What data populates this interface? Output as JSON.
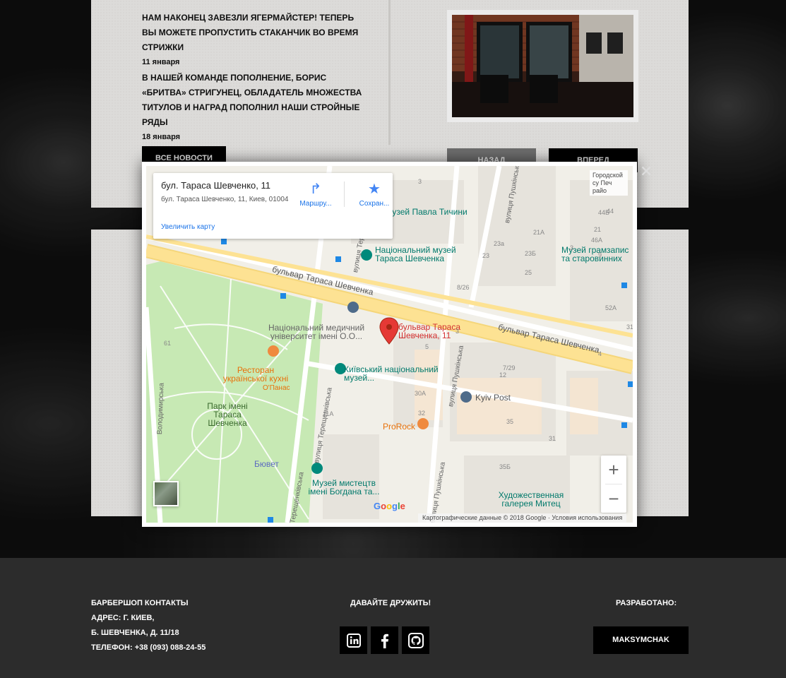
{
  "news": {
    "items": [
      {
        "title": "НАМ НАКОНЕЦ ЗАВЕЗЛИ ЯГЕРМАЙСТЕР! ТЕПЕРЬ ВЫ МОЖЕТЕ ПРОПУСТИТЬ СТАКАНЧИК ВО ВРЕМЯ СТРИЖКИ",
        "date": "11 января"
      },
      {
        "title": "В НАШЕЙ КОМАНДЕ ПОПОЛНЕНИЕ, БОРИС «БРИТВА» СТРИГУНЕЦ, ОБЛАДАТЕЛЬ МНОЖЕСТВА ТИТУЛОВ И НАГРАД ПОПОЛНИЛ НАШИ СТРОЙНЫЕ РЯДЫ",
        "date": "18 января"
      }
    ],
    "all_news_label": "ВСЕ НОВОСТИ",
    "back_label": "НАЗАД",
    "forward_label": "ВПЕРЕД"
  },
  "map": {
    "card": {
      "title": "бул. Тараса Шевченко, 11",
      "address": "бул. Тараса Шевченко, 11, Киев, 01004",
      "enlarge_link": "Увеличить карту",
      "route_label": "Маршру...",
      "save_label": "Сохран..."
    },
    "fullscreen_text": "Городской су Печ райо",
    "pin_label": "бульвар Тараса Шевченка, 11",
    "labels": {
      "museum_tychyny": "музей Павла Тичини",
      "museum_shevchenko": "Національний музей Тараса Шевченка",
      "museum_gramzapis": "Музей грамзапис та старовинних",
      "boulevard_1": "бульвар Тараса Шевченка",
      "boulevard_2": "бульвар Тараса Шевченка",
      "med_university": "Національний медичний університет імені О.О...",
      "restaurant": "Ресторан української кухні",
      "restaurant_sub": "О'Панас",
      "kyiv_museum": "Київський національний музей...",
      "kyiv_post": "Kyiv Post",
      "park": "Парк імені Тараса Шевченка",
      "prorock": "ProRock",
      "buvet": "Бювет",
      "museum_khanenko": "Музей мистецтв імені Богдана та...",
      "art_gallery": "Художественная галерея Митец",
      "st_volodymyrska": "Володимирська",
      "st_tereshchenkivska": "вулиця Терещенківська",
      "st_pushkinska": "вулиця Пушкінська",
      "st_pushkinska_2": "вулиця Пушкінська",
      "st_tereshchenkivska_2": "Терещенківська",
      "st_pushkinska_top": "вулиця Пушкінська",
      "st_tereshchenkivska_top": "вулиця Терещенківська"
    },
    "numbers": [
      "3",
      "44",
      "44Б",
      "21А",
      "21",
      "46А",
      "23а",
      "23Б",
      "23",
      "25",
      "8/26",
      "52А",
      "31",
      "3",
      "5",
      "12",
      "7/29",
      "61",
      "30А",
      "32",
      "11А",
      "35",
      "31",
      "35Б",
      "9",
      "3",
      "4"
    ],
    "google_logo": "Google",
    "attribution": "Картографические данные © 2018 Google · Условия использования",
    "zoom_in": "+",
    "zoom_out": "−",
    "close": "✕"
  },
  "footer": {
    "contacts": {
      "heading": "БАРБЕРШОП КОНТАКТЫ",
      "address_1": "АДРЕС: Г. КИЕВ,",
      "address_2": "Б. ШЕВЧЕНКА, Д. 11/18",
      "phone": "ТЕЛЕФОН: +38 (093) 088-24-55"
    },
    "social_heading": "ДАВАЙТЕ ДРУЖИТЬ!",
    "social_icons": [
      "linkedin-icon",
      "facebook-icon",
      "github-icon"
    ],
    "dev_heading": "РАЗРАБОТАНО:",
    "dev_button": "MAKSYMCHAK"
  },
  "colors": {
    "accent_pin": "#e53935",
    "road_major": "#fde293",
    "park": "#c7e9b4",
    "link": "#1a73e8"
  }
}
